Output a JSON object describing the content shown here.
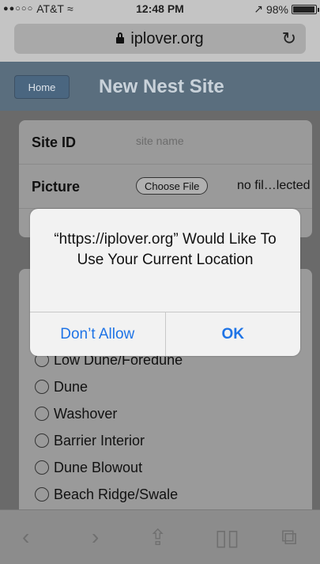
{
  "status": {
    "carrier": "AT&T",
    "time": "12:48 PM",
    "battery": "98%",
    "battery_level": 0.98
  },
  "browser": {
    "url": "iplover.org"
  },
  "nav": {
    "home_label": "Home",
    "title": "New Nest Site"
  },
  "form": {
    "site_id_label": "Site ID",
    "site_id_placeholder": "site name",
    "picture_label": "Picture",
    "choose_file_label": "Choose File",
    "file_status": "no fil…lected"
  },
  "habitat_options": [
    "Low Dune/Foredune",
    "Dune",
    "Washover",
    "Barrier Interior",
    "Dune Blowout",
    "Beach Ridge/Swale"
  ],
  "alert": {
    "message": "“https://iplover.org” Would Like To Use Your Current Location",
    "deny_label": "Don’t Allow",
    "ok_label": "OK"
  },
  "toolbar_icons": [
    "back-icon",
    "forward-icon",
    "share-icon",
    "bookmarks-icon",
    "tabs-icon"
  ]
}
